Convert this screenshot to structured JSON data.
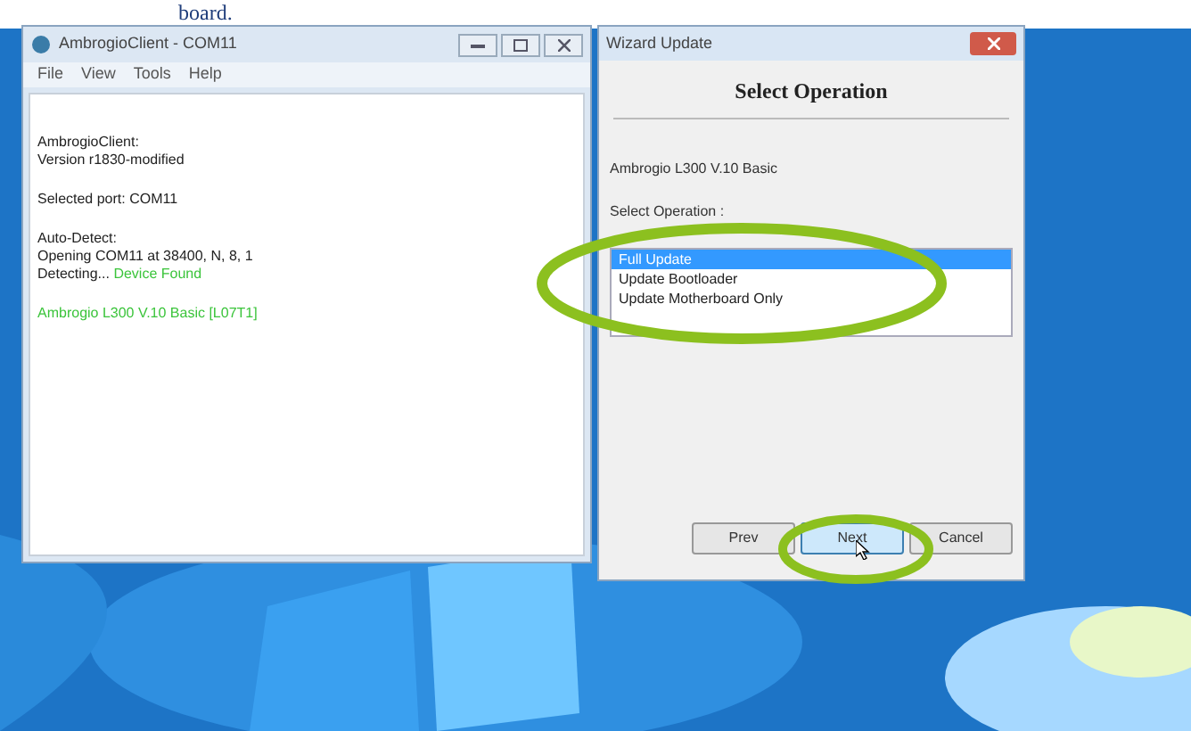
{
  "caption": "board.",
  "client_window": {
    "title": "AmbrogioClient - COM11",
    "menu": [
      "File",
      "View",
      "Tools",
      "Help"
    ],
    "log_blocks": [
      [
        [
          {
            "text": "AmbrogioClient:",
            "kind": "normal"
          }
        ],
        [
          {
            "text": "Version r1830-modified",
            "kind": "normal"
          }
        ]
      ],
      [
        [
          {
            "text": "Selected port: COM11",
            "kind": "normal"
          }
        ]
      ],
      [
        [
          {
            "text": "Auto-Detect:",
            "kind": "normal"
          }
        ],
        [
          {
            "text": "Opening COM11 at 38400, N, 8, 1",
            "kind": "normal"
          }
        ],
        [
          {
            "text": "Detecting... ",
            "kind": "normal"
          },
          {
            "text": "Device Found",
            "kind": "success"
          }
        ]
      ],
      [
        [
          {
            "text": "Ambrogio L300 V.10 Basic [L07T1]",
            "kind": "success"
          }
        ]
      ]
    ]
  },
  "wizard_window": {
    "title": "Wizard Update",
    "heading": "Select Operation",
    "device": "Ambrogio L300 V.10 Basic",
    "list_label": "Select Operation :",
    "operations": [
      {
        "label": "Full Update",
        "selected": true
      },
      {
        "label": "Update Bootloader",
        "selected": false
      },
      {
        "label": "Update Motherboard Only",
        "selected": false
      }
    ],
    "buttons": [
      {
        "label": "Prev",
        "hovered": false
      },
      {
        "label": "Next",
        "hovered": true
      },
      {
        "label": "Cancel",
        "hovered": false
      }
    ]
  }
}
